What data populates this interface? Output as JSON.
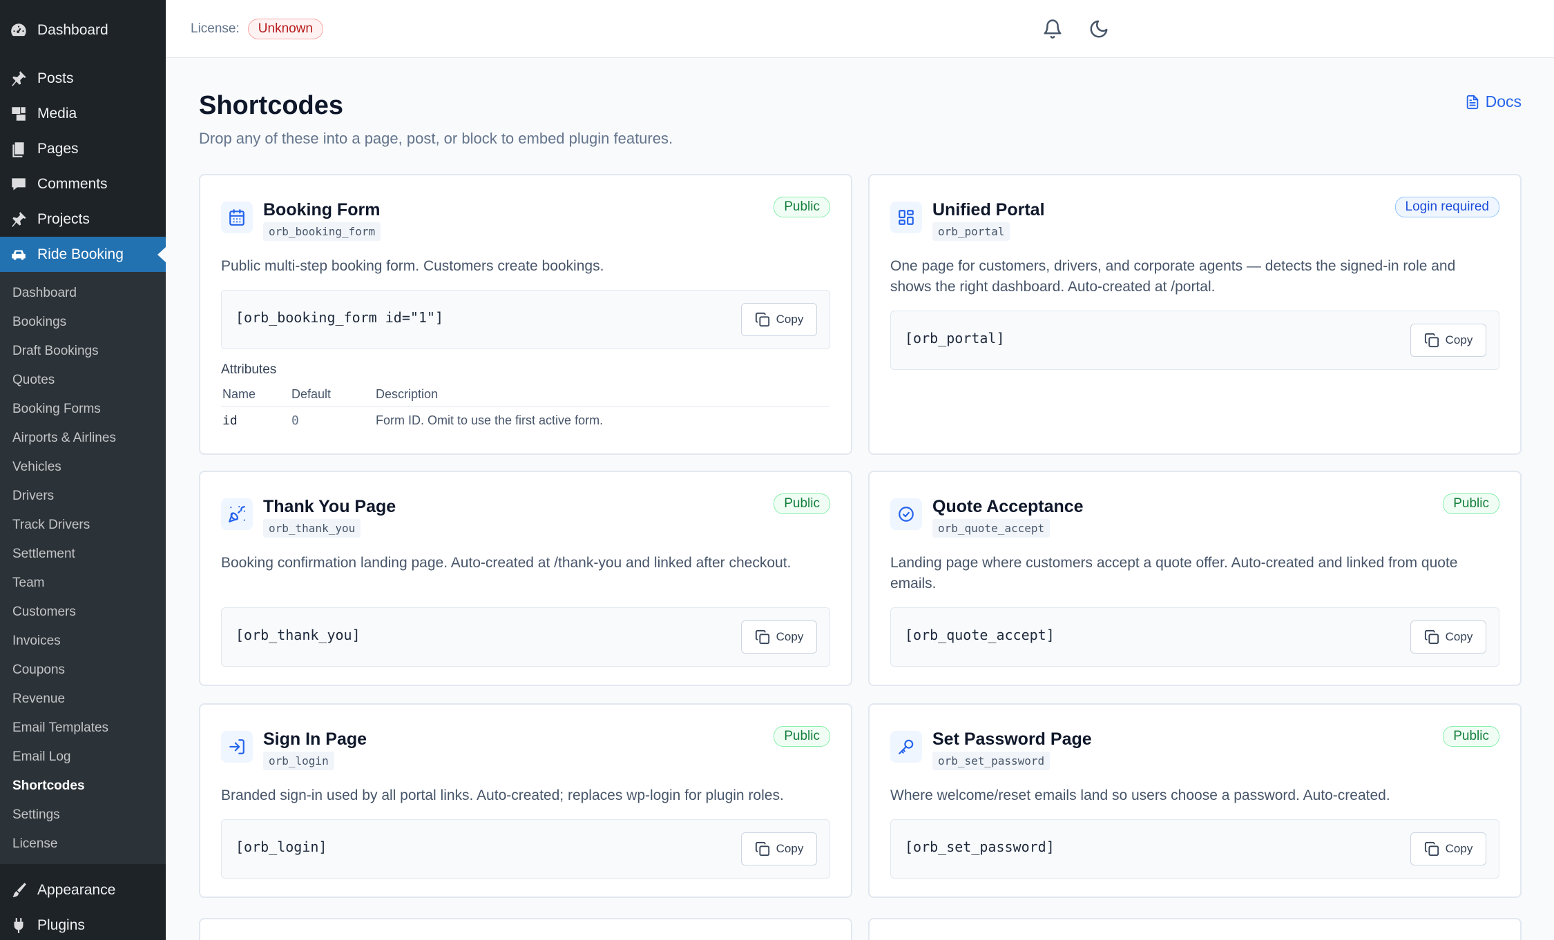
{
  "sidebar": {
    "menu_top": [
      {
        "label": "Dashboard",
        "icon": "dashboard-icon"
      },
      {
        "label": "Posts",
        "icon": "pin-icon"
      },
      {
        "label": "Media",
        "icon": "media-icon"
      },
      {
        "label": "Pages",
        "icon": "pages-icon"
      },
      {
        "label": "Comments",
        "icon": "comments-icon"
      },
      {
        "label": "Projects",
        "icon": "pin-icon"
      },
      {
        "label": "Ride Booking",
        "icon": "car-icon"
      }
    ],
    "submenu": [
      "Dashboard",
      "Bookings",
      "Draft Bookings",
      "Quotes",
      "Booking Forms",
      "Airports & Airlines",
      "Vehicles",
      "Drivers",
      "Track Drivers",
      "Settlement",
      "Team",
      "Customers",
      "Invoices",
      "Coupons",
      "Revenue",
      "Email Templates",
      "Email Log",
      "Shortcodes",
      "Settings",
      "License"
    ],
    "menu_bottom": [
      {
        "label": "Appearance",
        "icon": "brush-icon"
      },
      {
        "label": "Plugins",
        "icon": "plugin-icon"
      }
    ]
  },
  "topbar": {
    "license_label": "License:",
    "license_status": "Unknown"
  },
  "page": {
    "title": "Shortcodes",
    "subtitle": "Drop any of these into a page, post, or block to embed plugin features.",
    "docs_label": "Docs"
  },
  "cards": [
    {
      "title": "Booking Form",
      "tag": "orb_booking_form",
      "badge": "Public",
      "description": "Public multi-step booking form. Customers create bookings.",
      "code": "[orb_booking_form id=\"1\"]",
      "copy_label": "Copy",
      "attributes": {
        "heading": "Attributes",
        "columns": [
          "Name",
          "Default",
          "Description"
        ],
        "rows": [
          [
            "id",
            "0",
            "Form ID. Omit to use the first active form."
          ]
        ]
      }
    },
    {
      "title": "Unified Portal",
      "tag": "orb_portal",
      "badge": "Login required",
      "description": "One page for customers, drivers, and corporate agents — detects the signed-in role and shows the right dashboard. Auto-created at /portal.",
      "code": "[orb_portal]",
      "copy_label": "Copy"
    },
    {
      "title": "Thank You Page",
      "tag": "orb_thank_you",
      "badge": "Public",
      "description": "Booking confirmation landing page. Auto-created at /thank-you and linked after checkout.",
      "code": "[orb_thank_you]",
      "copy_label": "Copy"
    },
    {
      "title": "Quote Acceptance",
      "tag": "orb_quote_accept",
      "badge": "Public",
      "description": "Landing page where customers accept a quote offer. Auto-created and linked from quote emails.",
      "code": "[orb_quote_accept]",
      "copy_label": "Copy"
    },
    {
      "title": "Sign In Page",
      "tag": "orb_login",
      "badge": "Public",
      "description": "Branded sign-in used by all portal links. Auto-created; replaces wp-login for plugin roles.",
      "code": "[orb_login]",
      "copy_label": "Copy"
    },
    {
      "title": "Set Password Page",
      "tag": "orb_set_password",
      "badge": "Public",
      "description": "Where welcome/reset emails land so users choose a password. Auto-created.",
      "code": "[orb_set_password]",
      "copy_label": "Copy"
    }
  ],
  "colors": {
    "sidebar_bg": "#1d2327",
    "active_menu": "#2271b1",
    "accent": "#2563eb",
    "public_badge": "#15803d",
    "login_badge": "#1d4ed8",
    "license_unknown": "#b91c1c"
  }
}
